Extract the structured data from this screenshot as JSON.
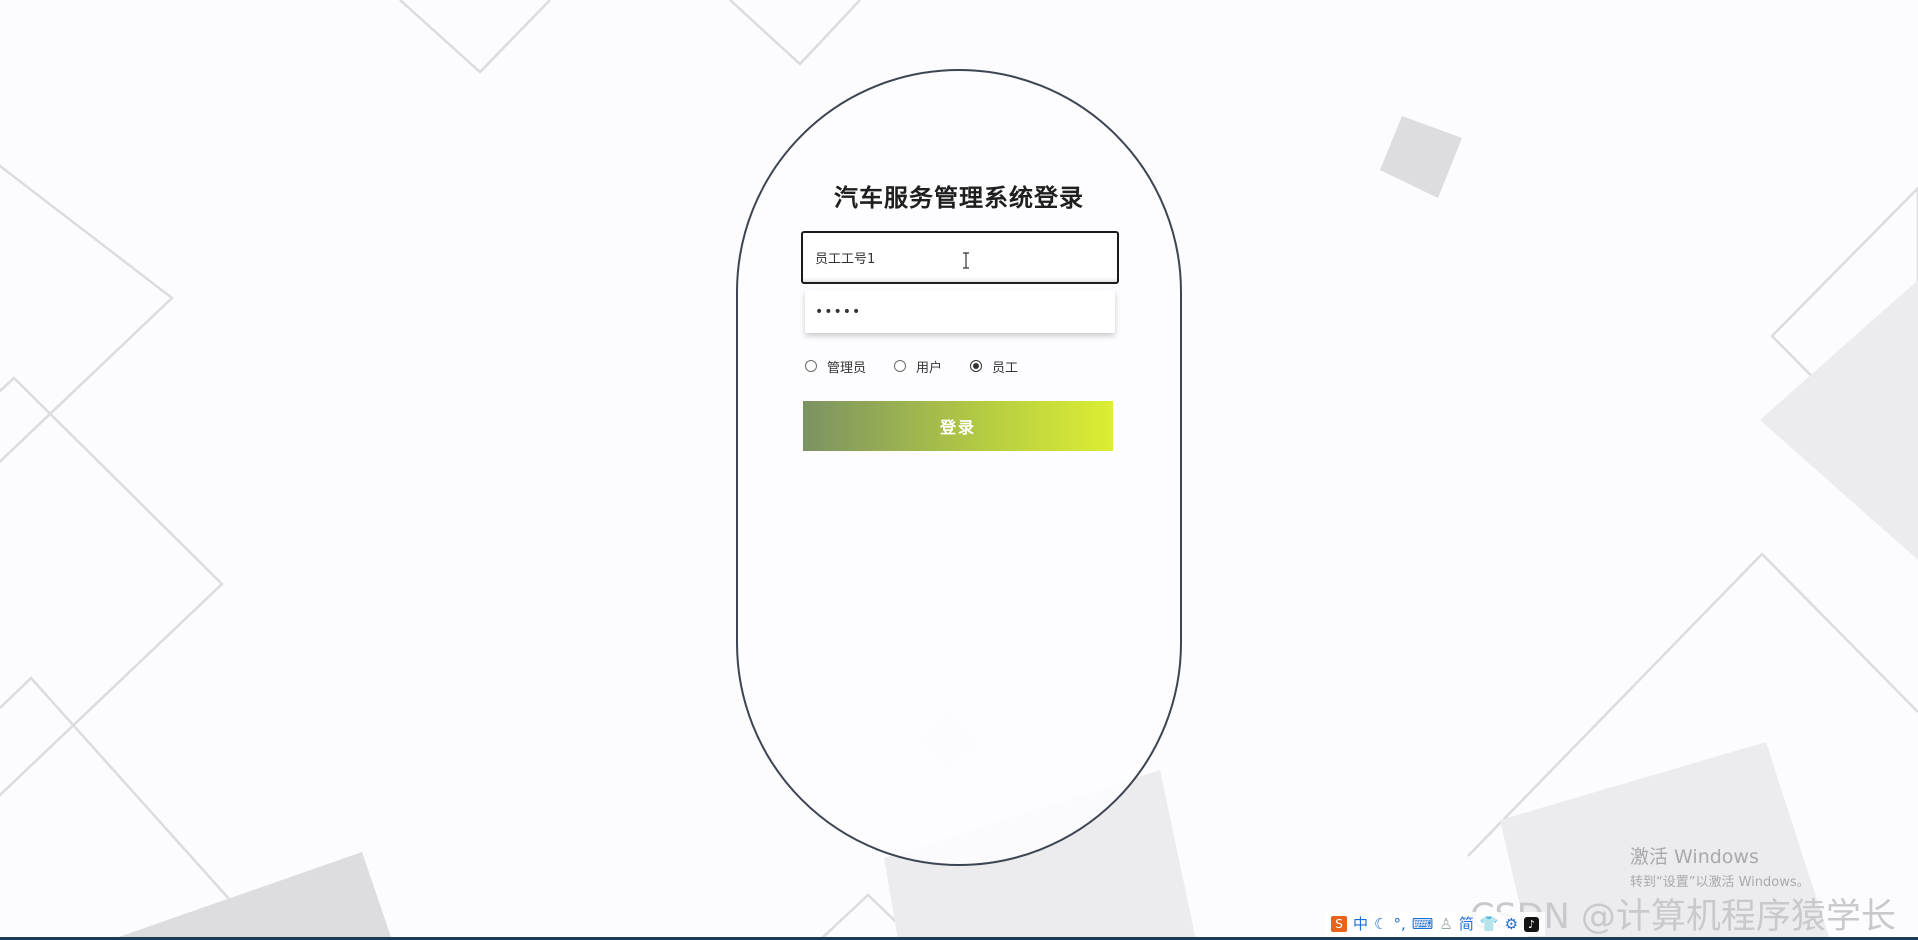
{
  "login": {
    "title": "汽车服务管理系统登录",
    "username_value": "员工工号1",
    "password_value": "•••••",
    "roles": [
      {
        "label": "管理员",
        "checked": false
      },
      {
        "label": "用户",
        "checked": false
      },
      {
        "label": "员工",
        "checked": true
      }
    ],
    "submit_label": "登录"
  },
  "overlay": {
    "activation_title": "激活 Windows",
    "activation_hint": "转到“设置”以激活 Windows。",
    "csdn_watermark": "CSDN @计算机程序猿学长"
  },
  "tray": {
    "icons": [
      "sogou-ime-icon",
      "chinese-mode-icon",
      "moon-icon",
      "punctuation-icon",
      "keyboard-icon",
      "user-icon",
      "simplified-icon",
      "skin-icon",
      "settings-icon",
      "tiktok-icon"
    ],
    "ime_mode": "中",
    "ime_script": "简"
  },
  "colors": {
    "capsule_border": "#3d4452",
    "button_gradient_start": "#7b9263",
    "button_gradient_end": "#dcee33",
    "taskbar": "#1d3a57"
  }
}
